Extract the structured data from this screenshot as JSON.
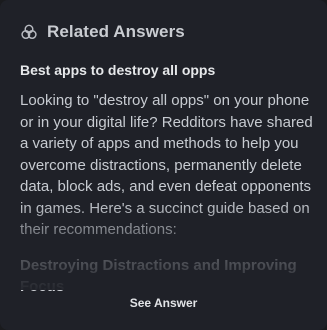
{
  "header": {
    "icon": "related-answers-icon",
    "title": "Related Answers"
  },
  "item": {
    "question": "Best apps to destroy all opps",
    "answer": "Looking to \"destroy all opps\" on your phone or in your digital life? Redditors have shared a variety of apps and methods to help you overcome distractions, permanently delete data, block ads, and even defeat opponents in games. Here's a succinct guide based on their recommendations:",
    "subheading": "Destroying Distractions and Improving Focus"
  },
  "footer": {
    "see_answer_label": "See Answer"
  },
  "colors": {
    "background": "#1f2128",
    "text": "#c7cbd1",
    "heading": "#e6e8ea"
  }
}
